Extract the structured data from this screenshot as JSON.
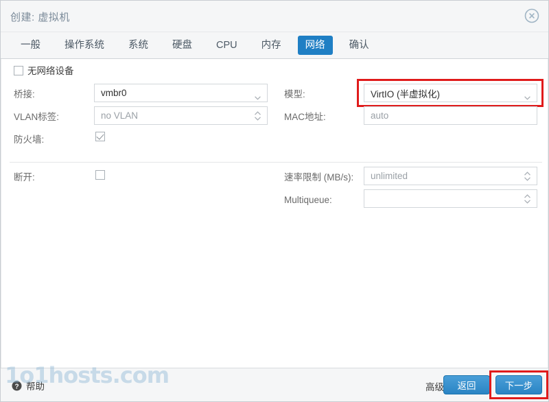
{
  "window": {
    "title": "创建: 虚拟机",
    "close_icon": "close-circle-icon",
    "accent_color": "#1f7fc4",
    "annotation_color": "#e01b1b"
  },
  "tabs": [
    {
      "label": "一般",
      "active": false
    },
    {
      "label": "操作系统",
      "active": false
    },
    {
      "label": "系统",
      "active": false
    },
    {
      "label": "硬盘",
      "active": false
    },
    {
      "label": "CPU",
      "active": false
    },
    {
      "label": "内存",
      "active": false
    },
    {
      "label": "网络",
      "active": true
    },
    {
      "label": "确认",
      "active": false
    }
  ],
  "form": {
    "no_network_device": {
      "label": "无网络设备",
      "checked": false
    },
    "left": {
      "bridge": {
        "label": "桥接:",
        "value": "vmbr0",
        "is_placeholder": false,
        "control": "dropdown"
      },
      "vlan_tag": {
        "label": "VLAN标签:",
        "value": "no VLAN",
        "is_placeholder": true,
        "control": "spinner"
      },
      "firewall": {
        "label": "防火墙:",
        "checked": true
      },
      "disconnect": {
        "label": "断开:",
        "checked": false
      }
    },
    "right": {
      "model": {
        "label": "模型:",
        "value": "VirtIO (半虚拟化)",
        "is_placeholder": false,
        "control": "dropdown",
        "highlighted": true
      },
      "mac_address": {
        "label": "MAC地址:",
        "value": "auto",
        "is_placeholder": true,
        "control": "text"
      },
      "rate_limit": {
        "label": "速率限制 (MB/s):",
        "value": "unlimited",
        "is_placeholder": true,
        "control": "spinner"
      },
      "multiqueue": {
        "label": "Multiqueue:",
        "value": "",
        "is_placeholder": true,
        "control": "spinner"
      }
    }
  },
  "footer": {
    "help_label": "帮助",
    "help_icon": "question-mark-circle-icon",
    "advanced_label": "高级",
    "advanced_checked": true,
    "back_label": "返回",
    "next_label": "下一步",
    "next_highlighted": true
  },
  "watermark": {
    "text": "1o1hosts.com"
  }
}
